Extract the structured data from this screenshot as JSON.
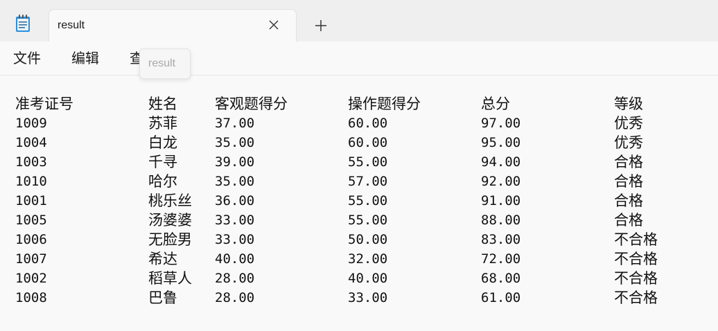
{
  "tab": {
    "title": "result"
  },
  "icons": {
    "app": "notepad-icon",
    "close": "close-icon",
    "new_tab": "plus-icon"
  },
  "menu": {
    "file": "文件",
    "edit": "编辑",
    "view": "查看"
  },
  "tooltip": {
    "text": "result"
  },
  "document": {
    "header": [
      "准考证号",
      "姓名",
      "客观题得分",
      "操作题得分",
      "总分",
      "等级"
    ],
    "rows": [
      [
        "1009",
        "苏菲",
        "37.00",
        "60.00",
        "97.00",
        "优秀"
      ],
      [
        "1004",
        "白龙",
        "35.00",
        "60.00",
        "95.00",
        "优秀"
      ],
      [
        "1003",
        "千寻",
        "39.00",
        "55.00",
        "94.00",
        "合格"
      ],
      [
        "1010",
        "哈尔",
        "35.00",
        "57.00",
        "92.00",
        "合格"
      ],
      [
        "1001",
        "桃乐丝",
        "36.00",
        "55.00",
        "91.00",
        "合格"
      ],
      [
        "1005",
        "汤婆婆",
        "33.00",
        "55.00",
        "88.00",
        "合格"
      ],
      [
        "1006",
        "无脸男",
        "33.00",
        "50.00",
        "83.00",
        "不合格"
      ],
      [
        "1007",
        "希达",
        "40.00",
        "32.00",
        "72.00",
        "不合格"
      ],
      [
        "1002",
        "稻草人",
        "28.00",
        "40.00",
        "68.00",
        "不合格"
      ],
      [
        "1008",
        "巴鲁",
        "28.00",
        "33.00",
        "61.00",
        "不合格"
      ]
    ]
  }
}
